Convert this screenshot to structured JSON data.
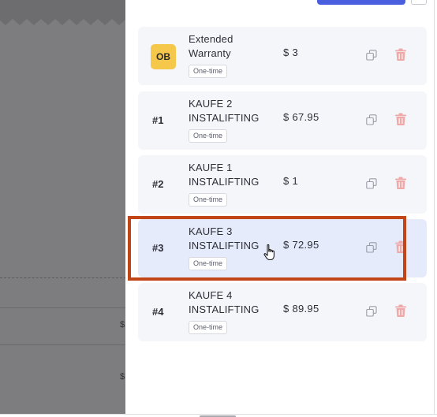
{
  "background": {
    "dollar_labels": [
      "$",
      "$"
    ]
  },
  "items": [
    {
      "badge": "OB",
      "name_line1": "Extended",
      "name_line2": "Warranty",
      "billing": "One-time",
      "price": "$ 3"
    },
    {
      "badge": "#1",
      "name_line1": "KAUFE 2",
      "name_line2": "INSTALIFTING",
      "billing": "One-time",
      "price": "$ 67.95"
    },
    {
      "badge": "#2",
      "name_line1": "KAUFE 1",
      "name_line2": "INSTALIFTING",
      "billing": "One-time",
      "price": "$ 1"
    },
    {
      "badge": "#3",
      "name_line1": "KAUFE 3",
      "name_line2": "INSTALIFTING",
      "billing": "One-time",
      "price": "$ 72.95"
    },
    {
      "badge": "#4",
      "name_line1": "KAUFE 4",
      "name_line2": "INSTALIFTING",
      "billing": "One-time",
      "price": "$ 89.95"
    }
  ],
  "icons": {
    "duplicate": "duplicate-icon",
    "delete": "trash-icon",
    "pointer": "hand-pointer-cursor"
  },
  "colors": {
    "highlight": "#c24518",
    "accent": "#4a5fe0",
    "badge_ob": "#f5c84b",
    "trash": "#f0a9a9"
  }
}
